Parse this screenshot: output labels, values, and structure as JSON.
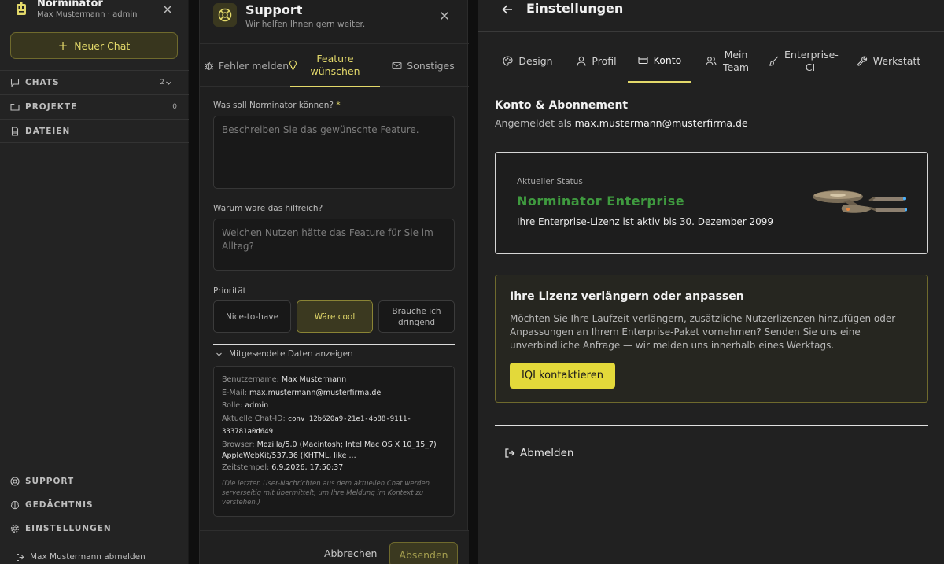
{
  "sidebar": {
    "app_name": "Norminator",
    "user_line": "Max Mustermann · admin",
    "new_chat_label": "Neuer Chat",
    "sections": {
      "chats": {
        "label": "CHATS",
        "count": "2"
      },
      "projects": {
        "label": "PROJEKTE",
        "count": "0"
      },
      "files": {
        "label": "DATEIEN"
      }
    },
    "bottom": {
      "support": "SUPPORT",
      "memory": "GEDÄCHTNIS",
      "settings": "EINSTELLUNGEN"
    },
    "logout_label": "Max Mustermann abmelden"
  },
  "support": {
    "title": "Support",
    "subtitle": "Wir helfen Ihnen gern weiter.",
    "tabs": {
      "bug": "Fehler melden",
      "feature": "Feature wünschen",
      "other": "Sonstiges"
    },
    "form": {
      "q1_label": "Was soll Norminator können?",
      "q1_required": "*",
      "q1_placeholder": "Beschreiben Sie das gewünschte Feature.",
      "q2_label": "Warum wäre das hilfreich?",
      "q2_placeholder": "Welchen Nutzen hätte das Feature für Sie im Alltag?",
      "priority_label": "Priorität",
      "priority_options": [
        "Nice-to-have",
        "Wäre cool",
        "Brauche ich dringend"
      ],
      "priority_selected": "Wäre cool"
    },
    "details": {
      "toggle_label": "Mitgesendete Daten anzeigen",
      "username_key": "Benutzername:",
      "username": "Max Mustermann",
      "email_key": "E-Mail:",
      "email": "max.mustermann@musterfirma.de",
      "role_key": "Rolle:",
      "role": "admin",
      "chat_id_key": "Aktuelle Chat-ID:",
      "chat_id": "conv_12b620a9-21e1-4b88-9111-333781a0d649",
      "browser_key": "Browser:",
      "browser": "Mozilla/5.0 (Macintosh; Intel Mac OS X 10_15_7) AppleWebKit/537.36 (KHTML, like ...",
      "timestamp_key": "Zeitstempel:",
      "timestamp": "6.9.2026, 17:50:37",
      "note": "(Die letzten User-Nachrichten aus dem aktuellen Chat werden serverseitig mit übermittelt, um Ihre Meldung im Kontext zu verstehen.)"
    },
    "cancel_label": "Abbrechen",
    "send_label": "Absenden"
  },
  "settings": {
    "title": "Einstellungen",
    "tabs": {
      "design": "Design",
      "profile": "Profil",
      "account": "Konto",
      "team": "Mein Team",
      "enterprise": "Enterprise-CI",
      "workshop": "Werkstatt"
    },
    "account": {
      "heading": "Konto & Abonnement",
      "logged_in_prefix": "Angemeldet als ",
      "email": "max.mustermann@musterfirma.de",
      "status_label": "Aktueller Status",
      "plan": "Norminator Enterprise",
      "license_text": "Ihre Enterprise-Lizenz ist aktiv bis 30. Dezember 2099",
      "extend_heading": "Ihre Lizenz verlängern oder anpassen",
      "extend_text": "Möchten Sie Ihre Laufzeit verlängern, zusätzliche Nutzerlizenzen hinzufügen oder Anpassungen an Ihrem Enterprise-Paket vornehmen? Senden Sie uns eine unverbindliche Anfrage — wir melden uns innerhalb eines Werktags.",
      "contact_label": "IQI kontaktieren",
      "logout_label": "Abmelden"
    }
  },
  "colors": {
    "accent": "#e3d96a",
    "button_yellow": "#e3d93a",
    "plan_green": "#3f9a3f"
  }
}
